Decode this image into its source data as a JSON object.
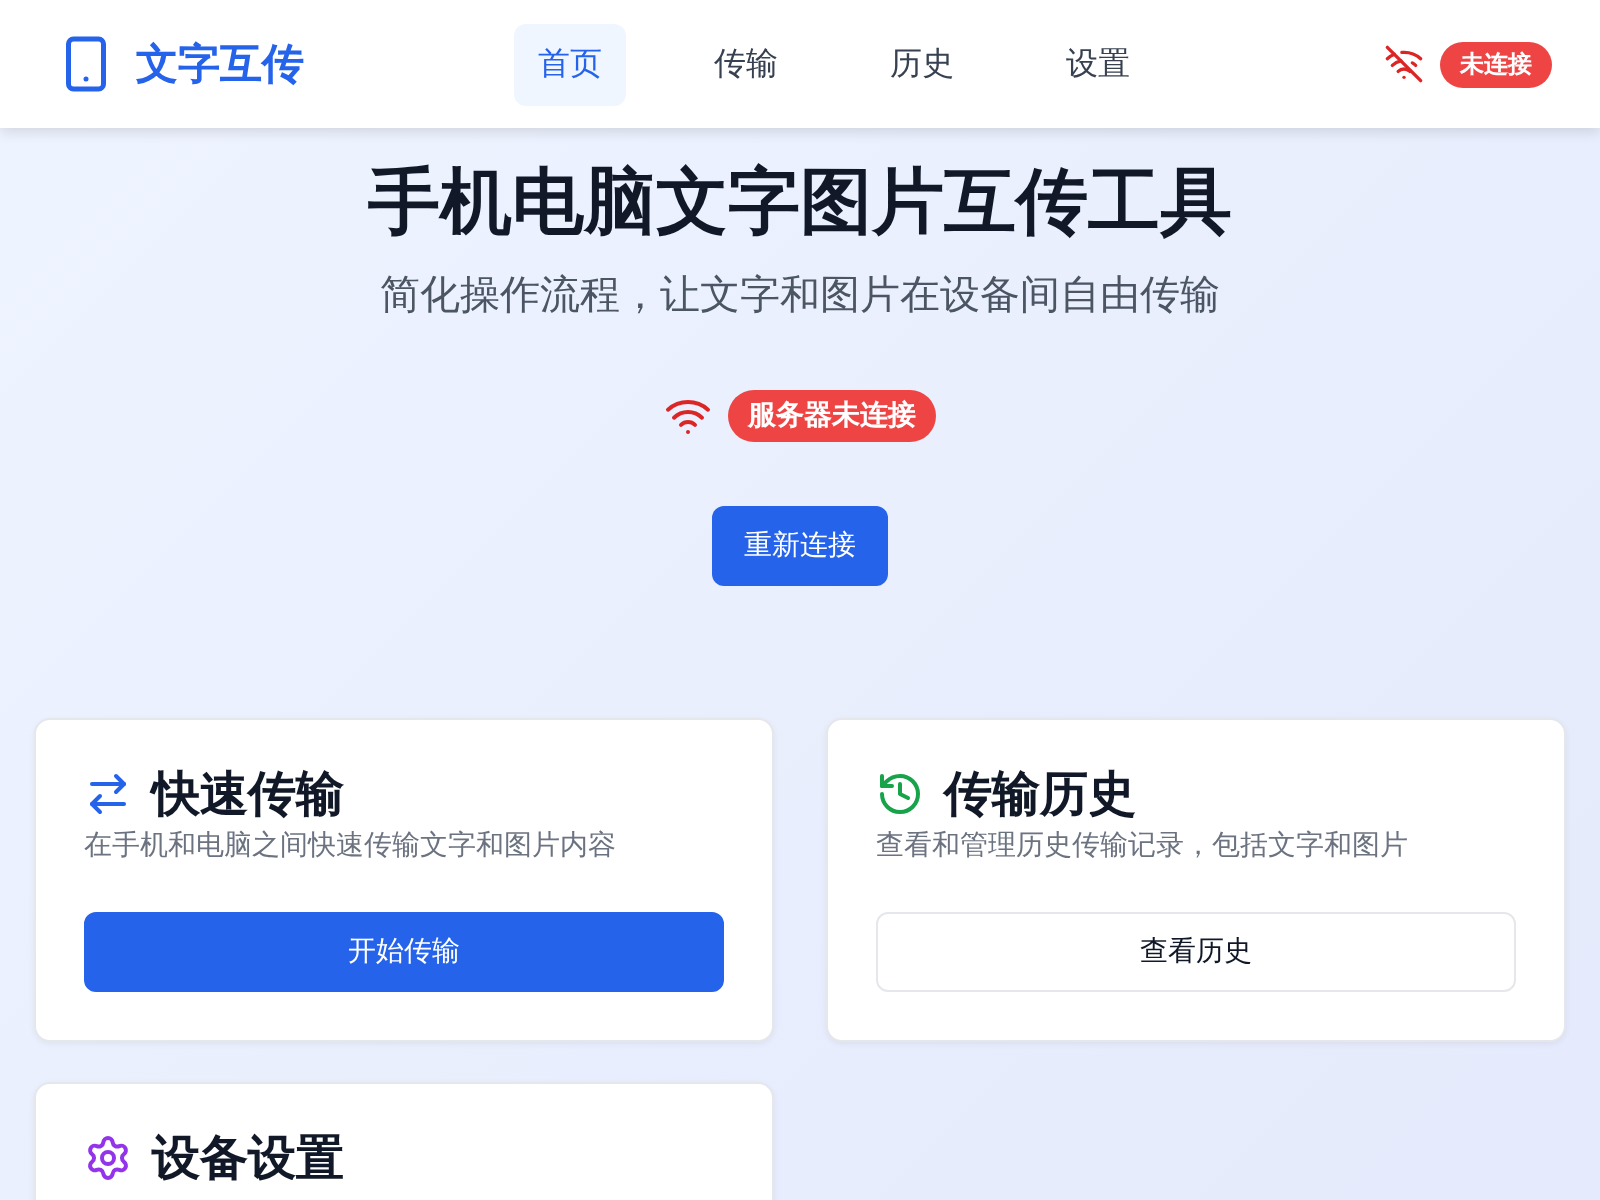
{
  "header": {
    "brand": "文字互传",
    "nav": [
      {
        "label": "首页",
        "selected": true
      },
      {
        "label": "传输",
        "selected": false
      },
      {
        "label": "历史",
        "selected": false
      },
      {
        "label": "设置",
        "selected": false
      }
    ],
    "connection": {
      "connected": false,
      "badge": "未连接"
    }
  },
  "hero": {
    "title": "手机电脑文字图片互传工具",
    "subtitle": "简化操作流程，让文字和图片在设备间自由传输",
    "status": {
      "connected": false,
      "badge": "服务器未连接"
    },
    "button": "重新连接"
  },
  "cards": [
    {
      "kind": "transfer",
      "color": "#2563eb",
      "title": "快速传输",
      "description": "在手机和电脑之间快速传输文字和图片内容",
      "button": {
        "label": "开始传输",
        "primary": true
      }
    },
    {
      "kind": "history",
      "color": "#16a34a",
      "title": "传输历史",
      "description": "查看和管理历史传输记录，包括文字和图片",
      "button": {
        "label": "查看历史",
        "primary": false
      }
    },
    {
      "kind": "settings",
      "color": "#9333ea",
      "title": "设备设置"
    }
  ]
}
